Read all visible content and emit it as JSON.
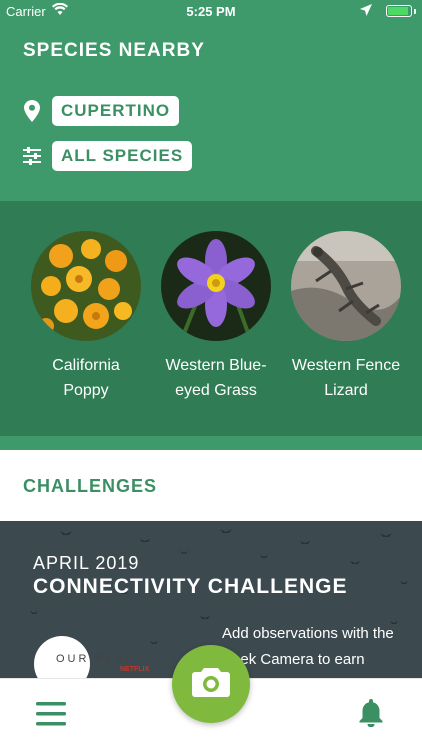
{
  "status_bar": {
    "carrier": "Carrier",
    "time": "5:25 PM"
  },
  "header": {
    "title": "SPECIES NEARBY",
    "location_label": "CUPERTINO",
    "species_filter_label": "ALL SPECIES"
  },
  "species": [
    {
      "name": "California Poppy",
      "icon": "california-poppy-photo"
    },
    {
      "name": "Western Blue-eyed Grass",
      "icon": "blue-eyed-grass-photo"
    },
    {
      "name": "Western Fence Lizard",
      "icon": "fence-lizard-photo"
    }
  ],
  "challenges": {
    "title": "CHALLENGES",
    "banner": {
      "month": "APRIL 2019",
      "name": "CONNECTIVITY CHALLENGE",
      "description": "Add observations with the Seek Camera to earn",
      "partner": "OUR PLANET",
      "partner_sub": "NETFLIX"
    }
  },
  "bottom_nav": {
    "menu_icon": "menu-icon",
    "camera_icon": "camera-icon",
    "bell_icon": "bell-icon"
  },
  "colors": {
    "header_green": "#3f9a6b",
    "species_band": "#2f7c55",
    "accent_text": "#3a8f63",
    "camera_green": "#7fb93d"
  }
}
